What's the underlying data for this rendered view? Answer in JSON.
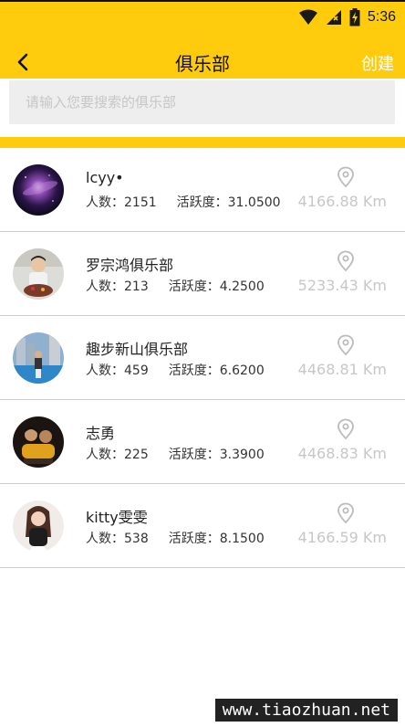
{
  "status_bar": {
    "time": "5:36"
  },
  "header": {
    "title": "俱乐部",
    "create_label": "创建"
  },
  "search": {
    "placeholder": "请输入您要搜索的俱乐部",
    "value": ""
  },
  "clubs": [
    {
      "name": "lcyy•",
      "members_label": "人数：",
      "members": "2151",
      "activity_label": "活跃度：",
      "activity": "31.0500",
      "distance": "4166.88 Km"
    },
    {
      "name": "罗宗鸿俱乐部",
      "members_label": "人数：",
      "members": "213",
      "activity_label": "活跃度：",
      "activity": "4.2500",
      "distance": "5233.43 Km"
    },
    {
      "name": "趣步新山俱乐部",
      "members_label": "人数：",
      "members": "459",
      "activity_label": "活跃度：",
      "activity": "6.6200",
      "distance": "4468.81 Km"
    },
    {
      "name": "志勇",
      "members_label": "人数：",
      "members": "225",
      "activity_label": "活跃度：",
      "activity": "3.3900",
      "distance": "4468.83 Km"
    },
    {
      "name": "kitty雯雯",
      "members_label": "人数：",
      "members": "538",
      "activity_label": "活跃度：",
      "activity": "8.1500",
      "distance": "4166.59 Km"
    }
  ],
  "watermark": "www.tiaozhuan.net",
  "colors": {
    "accent": "#FFCC0D",
    "divider": "#E6D27A",
    "distance": "#c7c7c7"
  }
}
